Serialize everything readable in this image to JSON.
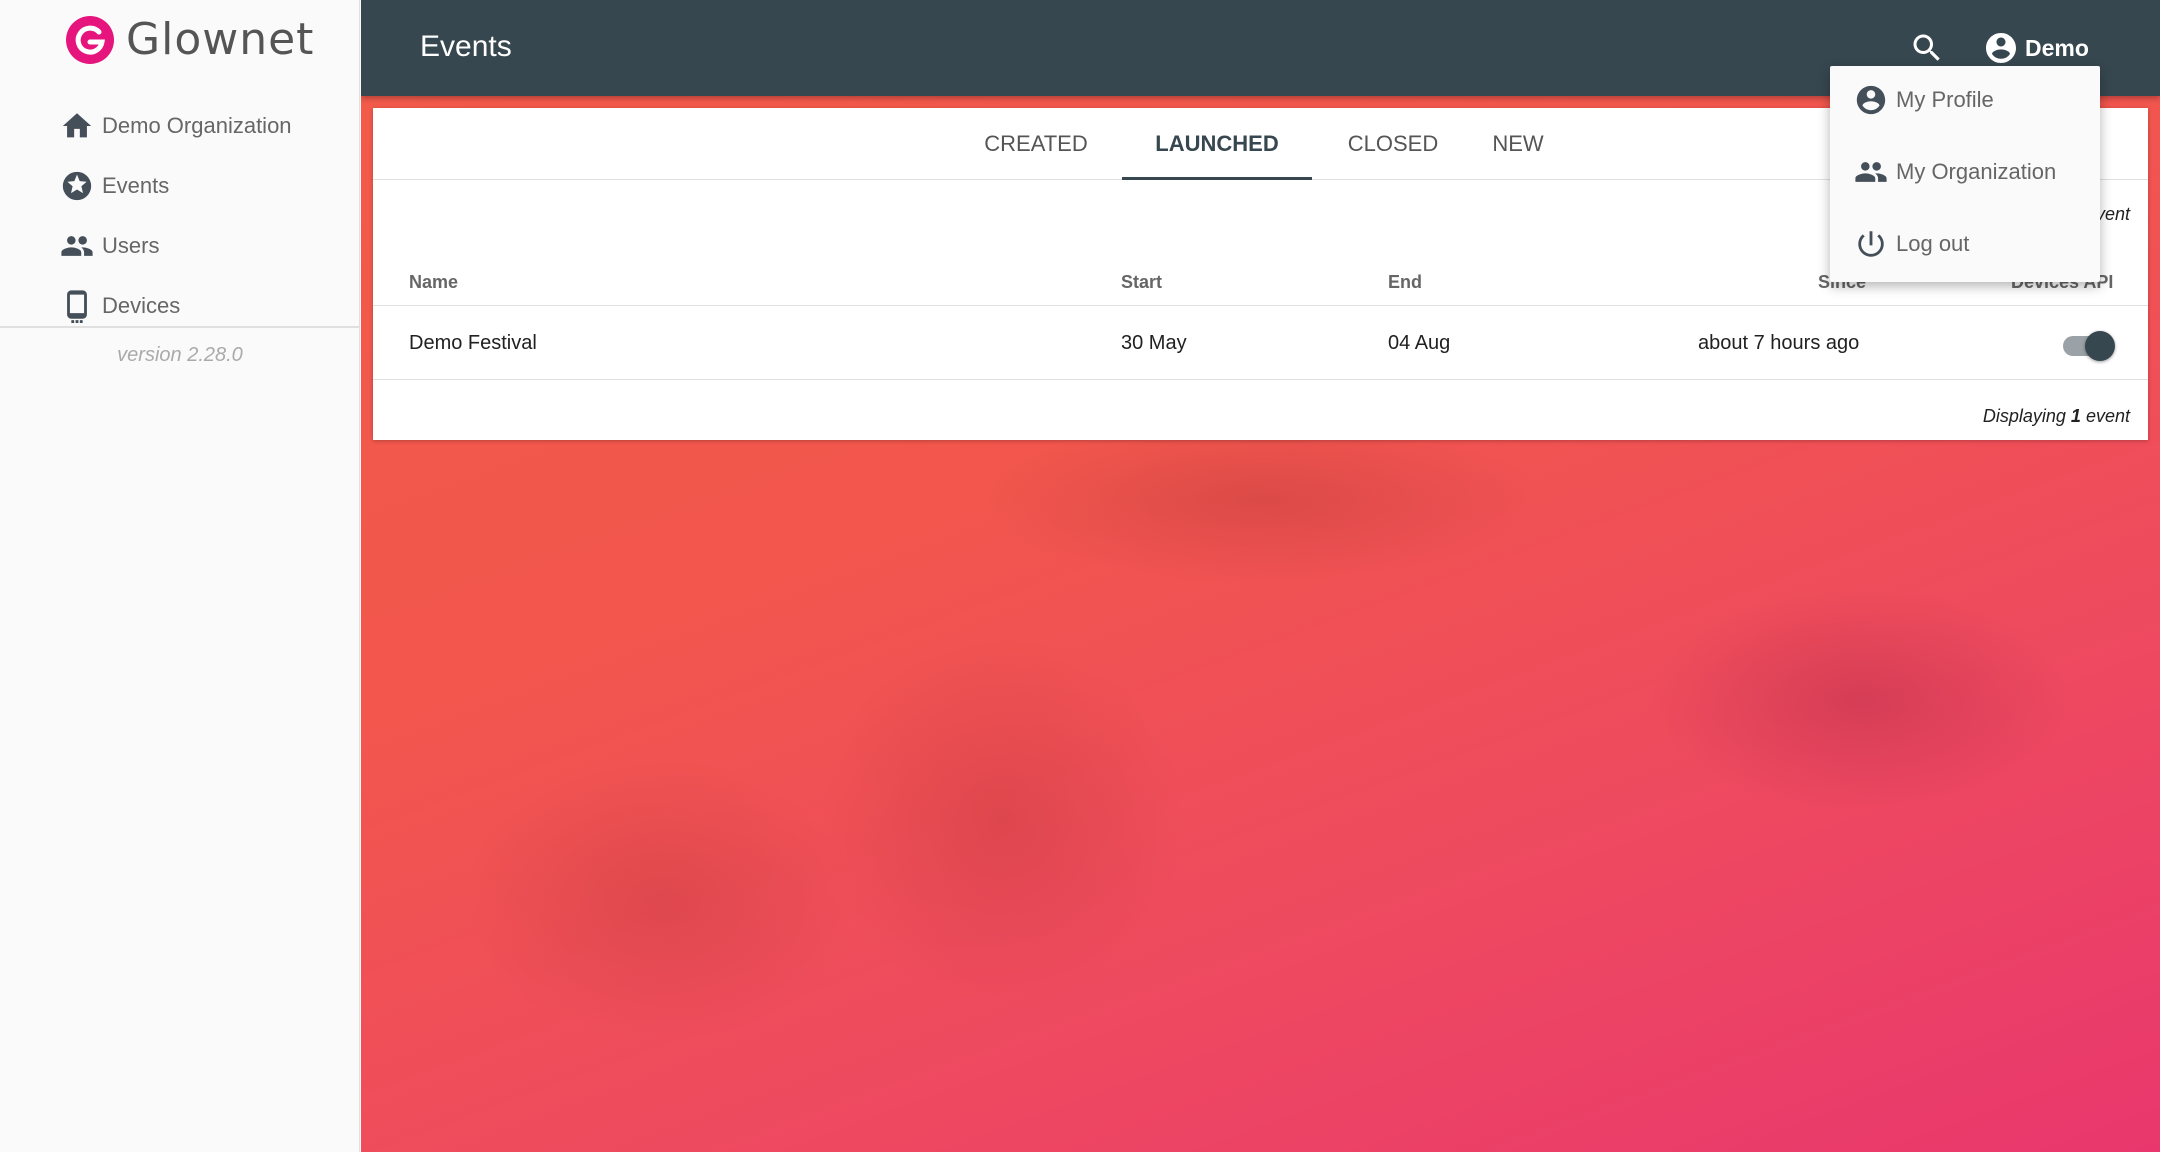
{
  "brand": {
    "name": "Glownet",
    "accent": "#e6157e"
  },
  "sidebar": {
    "items": [
      {
        "label": "Demo Organization",
        "icon": "home-icon"
      },
      {
        "label": "Events",
        "icon": "star-icon"
      },
      {
        "label": "Users",
        "icon": "users-icon"
      },
      {
        "label": "Devices",
        "icon": "phone-icon"
      }
    ],
    "version": "version 2.28.0"
  },
  "topbar": {
    "title": "Events",
    "user_label": "Demo",
    "color": "#37474f"
  },
  "tabs": [
    {
      "label": "CREATED",
      "active": false
    },
    {
      "label": "LAUNCHED",
      "active": true
    },
    {
      "label": "CLOSED",
      "active": false
    },
    {
      "label": "NEW",
      "active": false
    }
  ],
  "table": {
    "count_prefix": "Displaying",
    "count_value": "1",
    "count_suffix": "event",
    "headers": {
      "name": "Name",
      "start": "Start",
      "end": "End",
      "since": "Since",
      "devices_api": "Devices API"
    },
    "rows": [
      {
        "name": "Demo Festival",
        "start": "30 May",
        "end": "04 Aug",
        "since": "about 7 hours ago",
        "devices_api": true
      }
    ]
  },
  "user_menu": {
    "items": [
      {
        "label": "My Profile",
        "icon": "account-circle-icon"
      },
      {
        "label": "My Organization",
        "icon": "group-icon"
      },
      {
        "label": "Log out",
        "icon": "power-icon"
      }
    ]
  }
}
